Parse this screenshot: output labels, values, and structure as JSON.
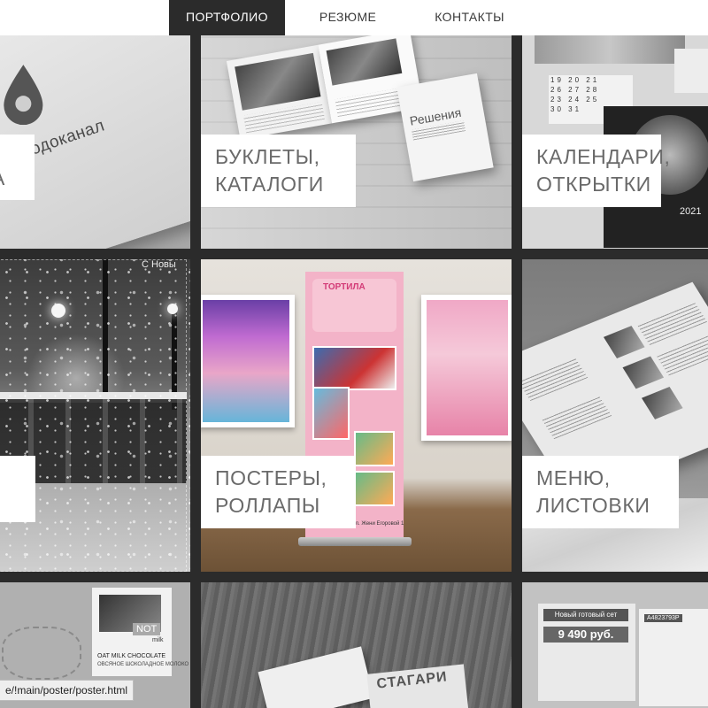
{
  "nav": {
    "items": [
      {
        "label": "ПОРТФОЛИО",
        "active": true
      },
      {
        "label": "РЕЗЮМЕ",
        "active": false
      },
      {
        "label": "КОНТАКТЫ",
        "active": false
      }
    ]
  },
  "tiles": {
    "logo": {
      "line1": "",
      "line2": "А",
      "logo_text": "осводоканал"
    },
    "booklets": {
      "line1": "БУКЛЕТЫ,",
      "line2": "КАТАЛОГИ",
      "cover_title": "Решения"
    },
    "calendars": {
      "line1": "КАЛЕНДАРИ,",
      "line2": "ОТКРЫТКИ",
      "year": "2021",
      "grid_rows": [
        "19 20 21",
        "26 27 28",
        "23 24 25",
        "30 31"
      ]
    },
    "winter": {
      "sign": "С Новы"
    },
    "posters": {
      "line1": "ПОСТЕРЫ,",
      "line2": "РОЛЛАПЫ",
      "rollup_title": "ТОРТИЛА",
      "rollup_footer": "Санкт-Петербург, ул. Жени Егоровой 1"
    },
    "menu": {
      "line1": "МЕНЮ,",
      "line2": "ЛИСТОВКИ"
    },
    "packaging": {
      "not_label": "NOT",
      "milk_label": "milk",
      "product": "OAT MILK CHOCOLATE",
      "product_sub": "ОВСЯНОЕ ШОКОЛАДНОЕ МОЛОКО"
    },
    "press": {
      "headline": "СТАГАРИ"
    },
    "ads": {
      "banner": "Новый готовый сет",
      "price": "9 490 руб.",
      "code": "A4823793P"
    }
  },
  "status_bar": {
    "url": "e/!main/poster/poster.html"
  }
}
